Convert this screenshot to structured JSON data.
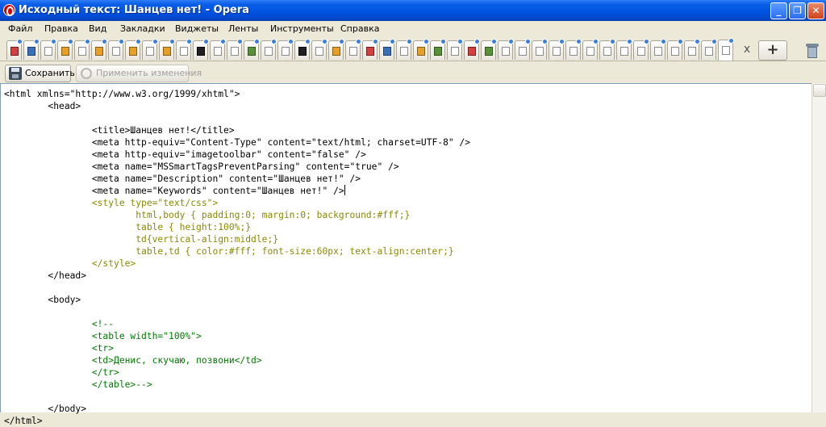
{
  "window": {
    "title": "Исходный текст: Шанцев нет! - Opera",
    "minimize_label": "_",
    "maximize_label": "❐",
    "close_label": "✕"
  },
  "menu": {
    "items": [
      "Файл",
      "Правка",
      "Вид",
      "Закладки",
      "Виджеты",
      "Ленты",
      "Инструменты",
      "Справка"
    ]
  },
  "tabs": {
    "count_label": "",
    "close_label": "x",
    "new_tab_label": "+"
  },
  "toolbar": {
    "save_label": "Сохранить",
    "apply_label": "Применить изменения"
  },
  "source": {
    "lines": [
      {
        "text": "<html xmlns=\"http://www.w3.org/1999/xhtml\">",
        "kind": "tag"
      },
      {
        "text": "        <head>",
        "kind": "tag"
      },
      {
        "text": "",
        "kind": "tag"
      },
      {
        "text": "                <title>Шанцев нет!</title>",
        "kind": "tag"
      },
      {
        "text": "                <meta http-equiv=\"Content-Type\" content=\"text/html; charset=UTF-8\" />",
        "kind": "tag"
      },
      {
        "text": "                <meta http-equiv=\"imagetoolbar\" content=\"false\" />",
        "kind": "tag"
      },
      {
        "text": "                <meta name=\"MSSmartTagsPreventParsing\" content=\"true\" />",
        "kind": "tag"
      },
      {
        "text": "                <meta name=\"Description\" content=\"Шанцев нет!\" />",
        "kind": "tag"
      },
      {
        "text": "                <meta name=\"Keywords\" content=\"Шанцев нет!\" />",
        "kind": "tag",
        "caret": true
      },
      {
        "text": "                <style type=\"text/css\">",
        "kind": "css"
      },
      {
        "text": "                        html,body { padding:0; margin:0; background:#fff;}",
        "kind": "css"
      },
      {
        "text": "                        table { height:100%;}",
        "kind": "css"
      },
      {
        "text": "                        td{vertical-align:middle;}",
        "kind": "css"
      },
      {
        "text": "                        table,td { color:#fff; font-size:60px; text-align:center;}",
        "kind": "css"
      },
      {
        "text": "                </style>",
        "kind": "css"
      },
      {
        "text": "        </head>",
        "kind": "tag"
      },
      {
        "text": "",
        "kind": "tag"
      },
      {
        "text": "        <body>",
        "kind": "tag"
      },
      {
        "text": "",
        "kind": "tag"
      },
      {
        "text": "                <!--",
        "kind": "cmt"
      },
      {
        "text": "                <table width=\"100%\">",
        "kind": "cmt"
      },
      {
        "text": "                <tr>",
        "kind": "cmt"
      },
      {
        "text": "                <td>Денис, скучаю, позвони</td>",
        "kind": "cmt"
      },
      {
        "text": "                </tr>",
        "kind": "cmt"
      },
      {
        "text": "                </table>-->",
        "kind": "cmt"
      },
      {
        "text": "",
        "kind": "tag"
      },
      {
        "text": "        </body>",
        "kind": "tag"
      },
      {
        "text": "</html>",
        "kind": "tag"
      }
    ]
  }
}
